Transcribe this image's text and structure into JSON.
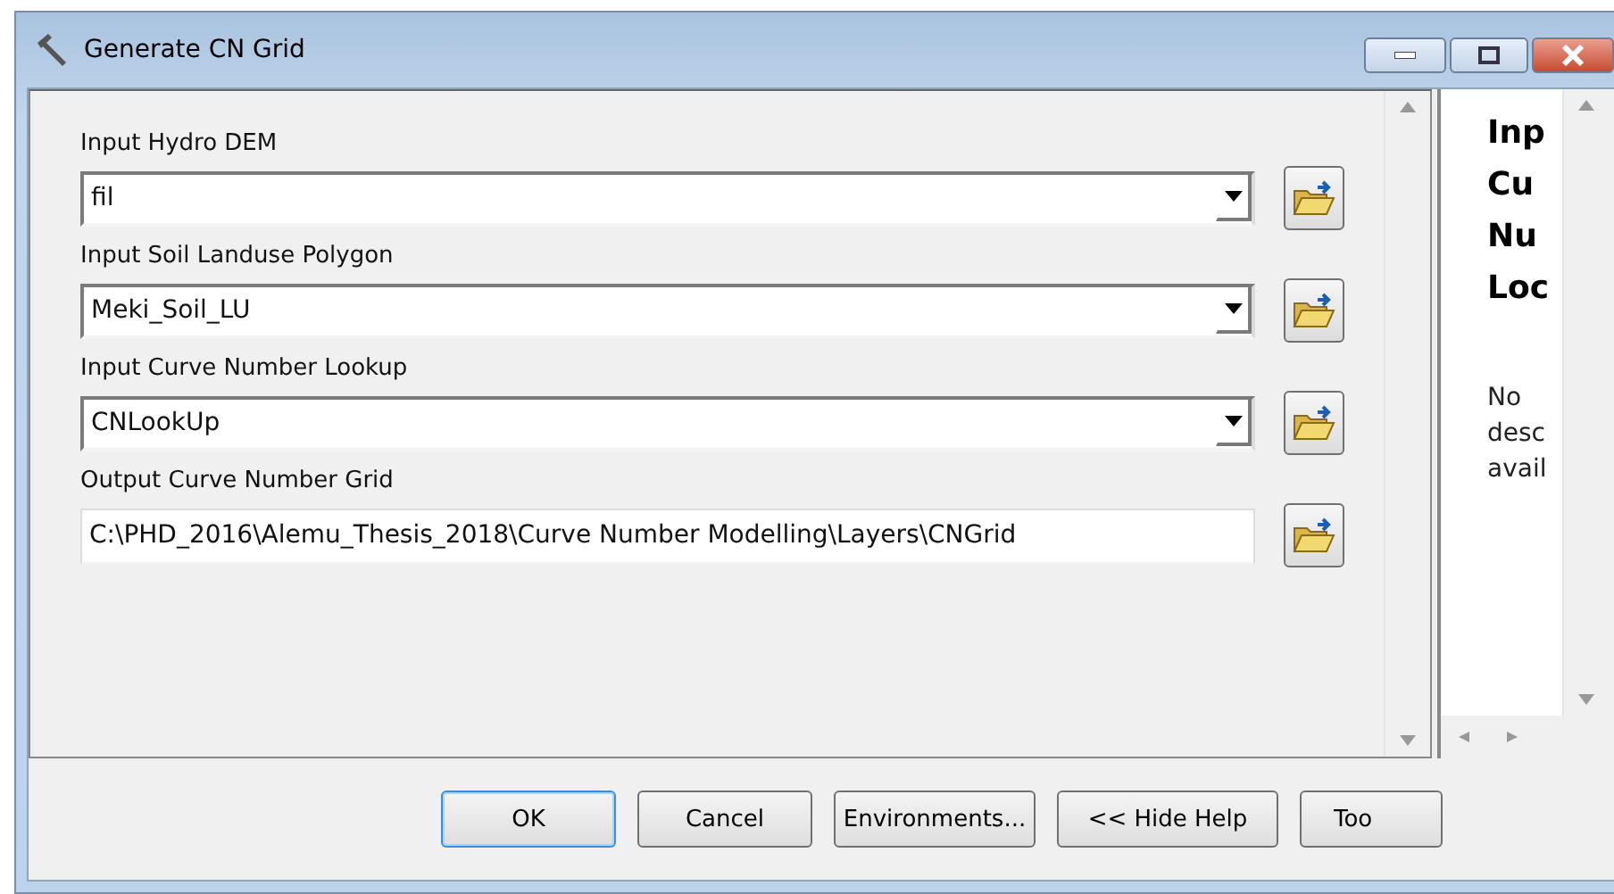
{
  "window": {
    "title": "Generate CN Grid"
  },
  "parameters": [
    {
      "label": "Input Hydro DEM",
      "kind": "dropdown",
      "value": "fil"
    },
    {
      "label": "Input Soil Landuse Polygon",
      "kind": "dropdown",
      "value": "Meki_Soil_LU"
    },
    {
      "label": "Input Curve Number Lookup",
      "kind": "dropdown",
      "value": "CNLookUp"
    },
    {
      "label": "Output Curve Number Grid",
      "kind": "text",
      "value": "C:\\PHD_2016\\Alemu_Thesis_2018\\Curve Number Modelling\\Layers\\CNGrid"
    }
  ],
  "help": {
    "title_lines": [
      "Inp",
      "Cu",
      "Nu",
      "Loc"
    ],
    "description_lines": [
      "No",
      "desc",
      "avail"
    ]
  },
  "buttons": [
    {
      "label": "OK",
      "selected": true
    },
    {
      "label": "Cancel",
      "selected": false
    },
    {
      "label": "Environments...",
      "selected": false
    },
    {
      "label": "<< Hide Help",
      "selected": false
    },
    {
      "label": "Too",
      "selected": false
    }
  ]
}
